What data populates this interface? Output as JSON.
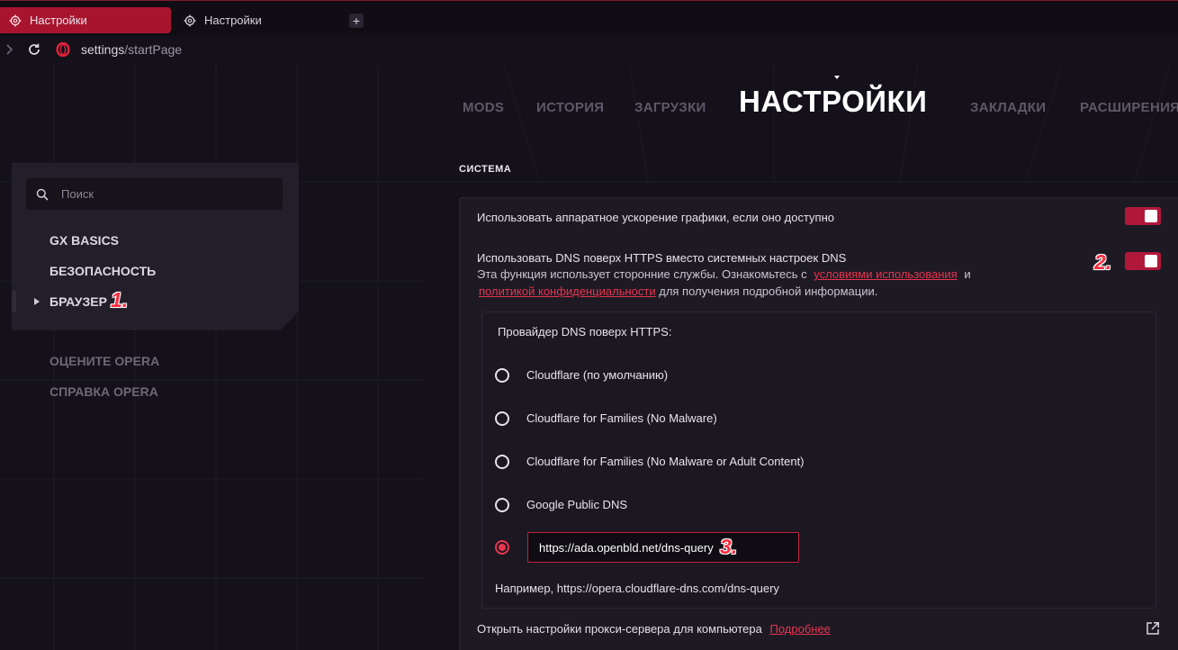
{
  "tabs": [
    {
      "label": "Настройки",
      "active": true
    },
    {
      "label": "Настройки",
      "active": false
    }
  ],
  "newtab_label": "+",
  "address": {
    "host": "settings",
    "path": "/startPage"
  },
  "topnav": {
    "items": [
      "MODS",
      "ИСТОРИЯ",
      "ЗАГРУЗКИ",
      "ЗАКЛАДКИ",
      "РАСШИРЕНИЯ"
    ],
    "title": "НАСТРОЙКИ"
  },
  "sidebar": {
    "search_placeholder": "Поиск",
    "items": [
      {
        "label": "GX BASICS"
      },
      {
        "label": "БЕЗОПАСНОСТЬ"
      },
      {
        "label": "БРАУЗЕР"
      }
    ],
    "secondary": [
      {
        "label": "ОЦЕНИТЕ OPERA"
      },
      {
        "label": "СПРАВКА OPERA"
      }
    ]
  },
  "annotations": [
    "1.",
    "2.",
    "3."
  ],
  "content": {
    "section_title": "СИСТЕМА",
    "hw_accel_label": "Использовать аппаратное ускорение графики, если оно доступно",
    "hw_accel_on": true,
    "doh_label": "Использовать DNS поверх HTTPS вместо системных настроек DNS",
    "doh_desc_1": "Эта функция использует сторонние службы. Ознакомьтесь с",
    "doh_link_terms": "условиями использования",
    "doh_desc_and": "и",
    "doh_link_privacy": "политикой конфиденциальности",
    "doh_desc_2": "для получения подробной информации.",
    "doh_on": true,
    "provider_title": "Провайдер DNS поверх HTTPS:",
    "providers": [
      {
        "label": "Cloudflare (по умолчанию)",
        "selected": false
      },
      {
        "label": "Cloudflare for Families (No Malware)",
        "selected": false
      },
      {
        "label": "Cloudflare for Families (No Malware or Adult Content)",
        "selected": false
      },
      {
        "label": "Google Public DNS",
        "selected": false
      }
    ],
    "custom_provider_value": "https://ada.openbld.net/dns-query",
    "custom_provider_selected": true,
    "example_text": "Например, https://opera.cloudflare-dns.com/dns-query",
    "proxy_label": "Открыть настройки прокси-сервера для компьютера",
    "proxy_link": "Подробнее"
  },
  "colors": {
    "accent": "#a8142d",
    "link": "#e5354f",
    "annotation": "#ff2b3d",
    "background": "#14111a"
  }
}
